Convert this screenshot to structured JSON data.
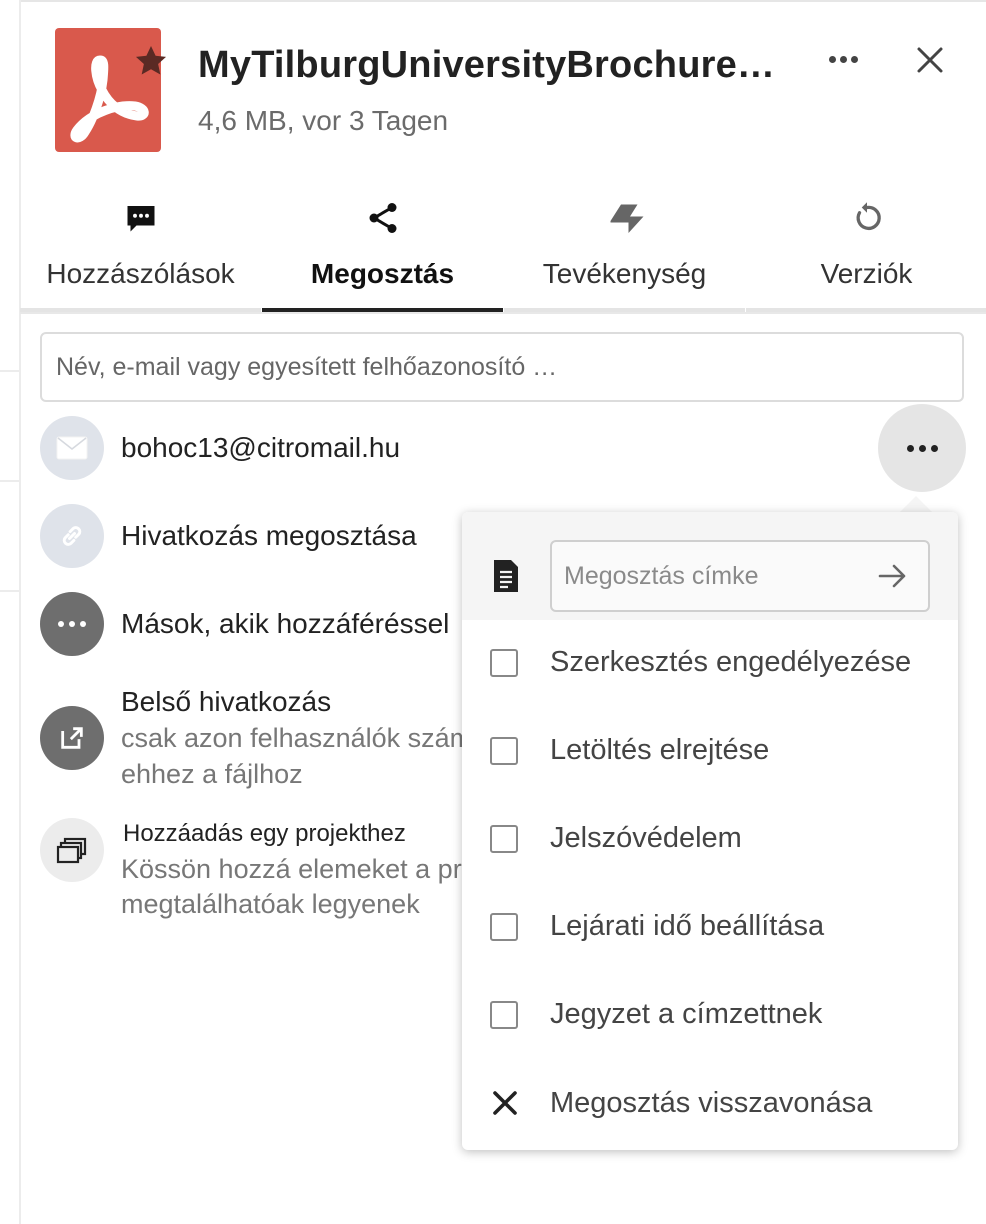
{
  "file": {
    "name": "MyTilburgUniversityBrochure…",
    "meta": "4,6 MB, vor 3 Tagen",
    "icon": "pdf-icon",
    "color": "#d9594c",
    "favorite": "star-icon"
  },
  "tabs": [
    {
      "label": "Hozzászólások",
      "icon": "comment-icon",
      "active": false
    },
    {
      "label": "Megosztás",
      "icon": "share-icon",
      "active": true
    },
    {
      "label": "Tevékenység",
      "icon": "activity-icon",
      "active": false
    },
    {
      "label": "Verziók",
      "icon": "history-icon",
      "active": false
    }
  ],
  "search": {
    "placeholder": "Név, e-mail vagy egyesített felhőazonosító …"
  },
  "shares": {
    "email": {
      "text": "bohoc13@citromail.hu",
      "icon": "mail-icon"
    },
    "link": {
      "text": "Hivatkozás megosztása",
      "icon": "link-icon"
    },
    "others": {
      "text": "Mások, akik hozzáféréssel",
      "icon": "more-icon"
    },
    "internal": {
      "title": "Belső hivatkozás",
      "sub1": "csak azon felhasználók számára működik, akik hozzáférnek",
      "sub2": "ehhez a fájlhoz",
      "icon": "external-link-icon"
    },
    "project": {
      "title": "Hozzáadás egy projekthez",
      "sub1": "Kössön hozzá elemeket a projekthez, hogy könnyebben",
      "sub2": "megtalálhatóak legyenek",
      "icon": "projects-icon"
    }
  },
  "menu": {
    "label_placeholder": "Megosztás címke",
    "options": [
      {
        "label": "Szerkesztés engedélyezése",
        "checked": false
      },
      {
        "label": "Letöltés elrejtése",
        "checked": false
      },
      {
        "label": "Jelszóvédelem",
        "checked": false
      },
      {
        "label": "Lejárati idő beállítása",
        "checked": false
      },
      {
        "label": "Jegyzet a címzettnek",
        "checked": false
      }
    ],
    "unshare": "Megosztás visszavonása"
  }
}
